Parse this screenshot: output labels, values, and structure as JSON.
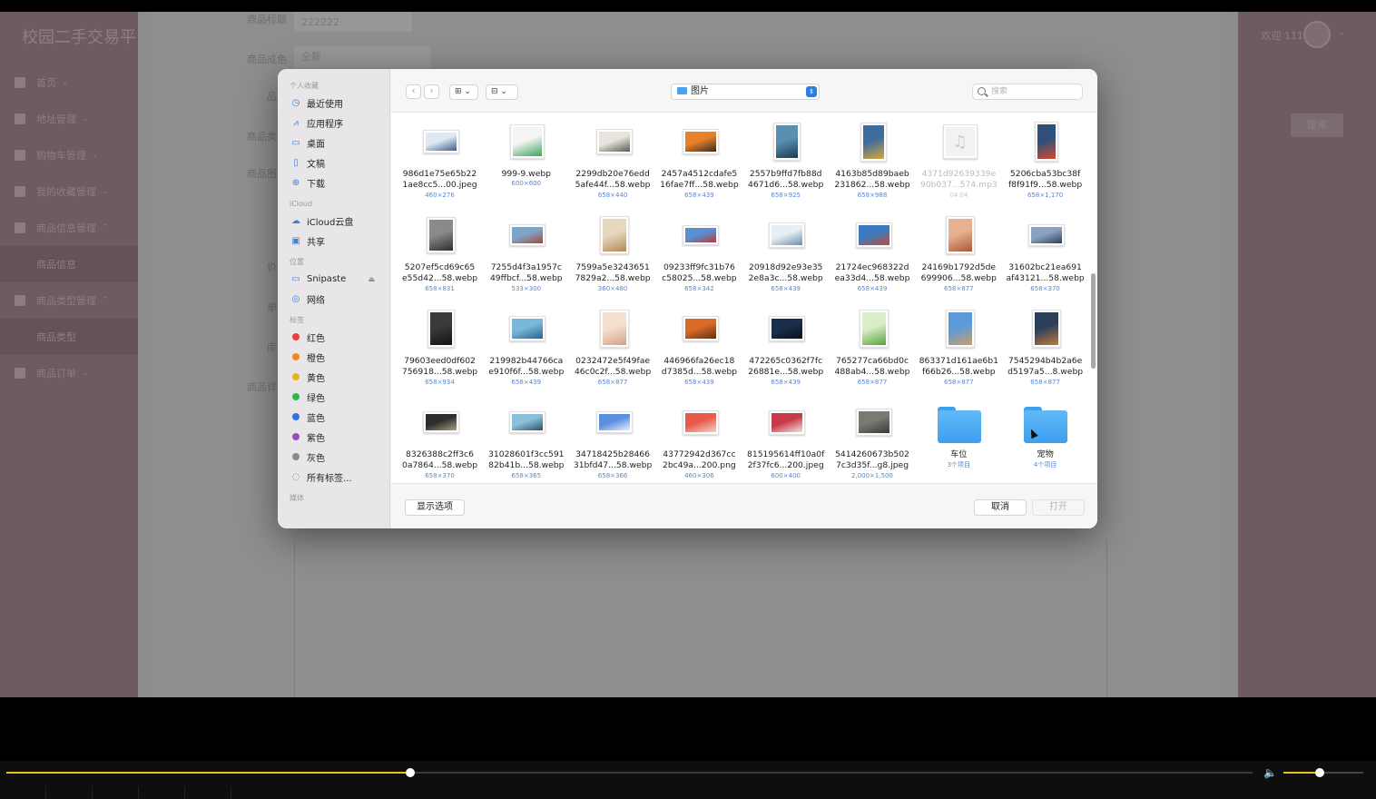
{
  "app": {
    "logo": "校园二手交易平",
    "welcome": "欢迎 111",
    "search_btn": "搜索",
    "menu": [
      {
        "label": "首页",
        "sub": false,
        "caret": "⌄"
      },
      {
        "label": "地址管理",
        "sub": false,
        "caret": "⌄"
      },
      {
        "label": "购物车管理",
        "sub": false,
        "caret": "⌄"
      },
      {
        "label": "我的收藏管理",
        "sub": false,
        "caret": "⌄"
      },
      {
        "label": "商品信息管理",
        "sub": false,
        "caret": "⌃"
      },
      {
        "label": "商品信息",
        "sub": true,
        "caret": ""
      },
      {
        "label": "商品类型管理",
        "sub": false,
        "caret": "⌃"
      },
      {
        "label": "商品类型",
        "sub": true,
        "caret": ""
      },
      {
        "label": "商品订单",
        "sub": false,
        "caret": "⌄"
      }
    ],
    "form": {
      "title_label": "商品标题",
      "title_value": "222222",
      "condition_label": "商品成色",
      "condition_value": "全新",
      "brand_label": "品牌",
      "type_label": "商品类型",
      "image_label": "商品图片",
      "price_label": "价格",
      "limit_label": "单限",
      "stock_label": "库存",
      "detail_label": "商品详情"
    }
  },
  "dialog": {
    "sidebar": {
      "favorites_header": "个人收藏",
      "favorites": [
        {
          "label": "最近使用",
          "icon": "clock-icon",
          "glyph": "◷"
        },
        {
          "label": "应用程序",
          "icon": "apps-icon",
          "glyph": "⩘"
        },
        {
          "label": "桌面",
          "icon": "desktop-icon",
          "glyph": "▭"
        },
        {
          "label": "文稿",
          "icon": "document-icon",
          "glyph": "▯"
        },
        {
          "label": "下载",
          "icon": "download-icon",
          "glyph": "⊕"
        }
      ],
      "icloud_header": "iCloud",
      "icloud": [
        {
          "label": "iCloud云盘",
          "icon": "cloud-icon",
          "glyph": "☁"
        },
        {
          "label": "共享",
          "icon": "shared-folder-icon",
          "glyph": "▣"
        }
      ],
      "locations_header": "位置",
      "locations": [
        {
          "label": "Snipaste",
          "icon": "drive-icon",
          "glyph": "▭",
          "eject": "⏏"
        },
        {
          "label": "网络",
          "icon": "network-icon",
          "glyph": "◎"
        }
      ],
      "tags_header": "标签",
      "tags": [
        {
          "label": "红色",
          "color": "#e8413b"
        },
        {
          "label": "橙色",
          "color": "#ef8a1d"
        },
        {
          "label": "黄色",
          "color": "#e8b321"
        },
        {
          "label": "绿色",
          "color": "#33b54a"
        },
        {
          "label": "蓝色",
          "color": "#2f74e0"
        },
        {
          "label": "紫色",
          "color": "#9b48c2"
        },
        {
          "label": "灰色",
          "color": "#8b8b8b"
        }
      ],
      "all_tags": "所有标签...",
      "media_header": "媒体"
    },
    "toolbar": {
      "back": "‹",
      "forward": "›",
      "view_icon": "⊞",
      "group_icon": "⊟",
      "location": "图片",
      "search_placeholder": "搜索"
    },
    "files": [
      {
        "name1": "986d1e75e65b22",
        "name2": "1ae8cc5...00.jpeg",
        "dims": "460×276",
        "c1": "#dfe9f3",
        "c2": "#3c5e8c",
        "w": 40,
        "h": 26
      },
      {
        "name1": "999-9.webp",
        "name2": "",
        "dims": "600×600",
        "c1": "#f5f5f5",
        "c2": "#3aa55a",
        "w": 38,
        "h": 38
      },
      {
        "name1": "2299db20e76edd",
        "name2": "5afe44f...58.webp",
        "dims": "658×440",
        "c1": "#e8e4dd",
        "c2": "#5c5a56",
        "w": 40,
        "h": 28
      },
      {
        "name1": "2457a4512cdafe5",
        "name2": "16fae7ff...58.webp",
        "dims": "658×439",
        "c1": "#e6822a",
        "c2": "#3a2a22",
        "w": 40,
        "h": 28
      },
      {
        "name1": "2557b9ffd7fb88d",
        "name2": "4671d6...58.webp",
        "dims": "658×925",
        "c1": "#5a8fb0",
        "c2": "#1d3a55",
        "w": 30,
        "h": 42
      },
      {
        "name1": "4163b85d89baeb",
        "name2": "231862...58.webp",
        "dims": "658×988",
        "c1": "#3d6d9a",
        "c2": "#d8a63a",
        "w": 29,
        "h": 43
      },
      {
        "name1": "4371d92639339e",
        "name2": "90b037...574.mp3",
        "dims": "04:04",
        "dim": true,
        "c1": "#f2f2f2",
        "c2": "#dcdcdc",
        "w": 38,
        "h": 38
      },
      {
        "name1": "5206cba53bc38f",
        "name2": "f8f91f9...58.webp",
        "dims": "658×1,170",
        "c1": "#2d4f7a",
        "c2": "#d6492f",
        "w": 26,
        "h": 44
      },
      {
        "name1": "5207ef5cd69c65",
        "name2": "e55d42...58.webp",
        "dims": "658×831",
        "c1": "#8a8a8a",
        "c2": "#2d2d2d",
        "w": 32,
        "h": 40
      },
      {
        "name1": "7255d4f3a1957c",
        "name2": "49ffbcf...58.webp",
        "dims": "533×300",
        "c1": "#7ea4c8",
        "c2": "#a44a3a",
        "w": 40,
        "h": 24
      },
      {
        "name1": "7599a5e3243651",
        "name2": "7829a2...58.webp",
        "dims": "360×480",
        "c1": "#e6d7bf",
        "c2": "#b58a55",
        "w": 32,
        "h": 42
      },
      {
        "name1": "09233ff9fc31b76",
        "name2": "c58025...58.webp",
        "dims": "658×342",
        "c1": "#5a8fd0",
        "c2": "#b33a3a",
        "w": 40,
        "h": 22
      },
      {
        "name1": "20918d92e93e35",
        "name2": "2e8a3c...58.webp",
        "dims": "658×439",
        "c1": "#e8eef4",
        "c2": "#6b8db0",
        "w": 40,
        "h": 28
      },
      {
        "name1": "21724ec968322d",
        "name2": "ea33d4...58.webp",
        "dims": "658×439",
        "c1": "#3c7bc0",
        "c2": "#c04a3a",
        "w": 40,
        "h": 28
      },
      {
        "name1": "24169b1792d5de",
        "name2": "699906...58.webp",
        "dims": "658×877",
        "c1": "#e7b08e",
        "c2": "#a8583a",
        "w": 32,
        "h": 42
      },
      {
        "name1": "31602bc21ea691",
        "name2": "af43121...58.webp",
        "dims": "658×370",
        "c1": "#8aa2c0",
        "c2": "#2d3f5a",
        "w": 40,
        "h": 24
      },
      {
        "name1": "79603eed0df602",
        "name2": "756918...58.webp",
        "dims": "658×934",
        "c1": "#3a3a3a",
        "c2": "#111",
        "w": 30,
        "h": 42
      },
      {
        "name1": "219982b44766ca",
        "name2": "e910f6f...58.webp",
        "dims": "658×439",
        "c1": "#7ab8d8",
        "c2": "#2c5f8a",
        "w": 40,
        "h": 28
      },
      {
        "name1": "0232472e5f49fae",
        "name2": "46c0c2f...58.webp",
        "dims": "658×877",
        "c1": "#f5e0cf",
        "c2": "#d3a088",
        "w": 32,
        "h": 42
      },
      {
        "name1": "446966fa26ec18",
        "name2": "d7385d...58.webp",
        "dims": "658×439",
        "c1": "#d86a2a",
        "c2": "#5a3018",
        "w": 40,
        "h": 28
      },
      {
        "name1": "472265c0362f7fc",
        "name2": "26881e...58.webp",
        "dims": "658×439",
        "c1": "#1a2d4a",
        "c2": "#0a121f",
        "w": 40,
        "h": 28
      },
      {
        "name1": "765277ca66bd0c",
        "name2": "488ab4...58.webp",
        "dims": "658×877",
        "c1": "#d8edc8",
        "c2": "#5aa33a",
        "w": 32,
        "h": 42
      },
      {
        "name1": "863371d161ae6b1",
        "name2": "f66b26...58.webp",
        "dims": "658×877",
        "c1": "#5a9ad8",
        "c2": "#c9a06a",
        "w": 32,
        "h": 42
      },
      {
        "name1": "7545294b4b2a6e",
        "name2": "d5197a5...8.webp",
        "dims": "658×877",
        "c1": "#2a3f5a",
        "c2": "#c07a3a",
        "w": 32,
        "h": 42
      },
      {
        "name1": "8326388c2ff3c6",
        "name2": "0a7864...58.webp",
        "dims": "658×370",
        "c1": "#2d2d2d",
        "c2": "#a8a080",
        "w": 40,
        "h": 24
      },
      {
        "name1": "31028601f3cc591",
        "name2": "82b41b...58.webp",
        "dims": "658×365",
        "c1": "#8ac0d8",
        "c2": "#2d4f6a",
        "w": 40,
        "h": 24
      },
      {
        "name1": "34718425b28466",
        "name2": "31bfd47...58.webp",
        "dims": "658×366",
        "c1": "#5a8fe0",
        "c2": "#e8f0fa",
        "w": 40,
        "h": 24
      },
      {
        "name1": "43772942d367cc",
        "name2": "2bc49a...200.png",
        "dims": "460×306",
        "c1": "#e85a4a",
        "c2": "#f5d0c8",
        "w": 40,
        "h": 27
      },
      {
        "name1": "815195614ff10a0f",
        "name2": "2f37fc6...200.jpeg",
        "dims": "600×400",
        "c1": "#c83a4a",
        "c2": "#f2e0e0",
        "w": 40,
        "h": 27
      },
      {
        "name1": "5414260673b502",
        "name2": "7c3d35f...g8.jpeg",
        "dims": "2,000×1,500",
        "c1": "#7a7a72",
        "c2": "#3a3a35",
        "w": 40,
        "h": 30
      },
      {
        "name1": "车位",
        "name2": "",
        "dims": "3个项目",
        "folder": true
      },
      {
        "name1": "宠物",
        "name2": "",
        "dims": "4个项目",
        "folder": true
      }
    ],
    "footer": {
      "options": "显示选项",
      "cancel": "取消",
      "open": "打开"
    }
  },
  "player": {
    "progress": 0.324,
    "volume": 0.45,
    "volume_icon": "🔈"
  }
}
